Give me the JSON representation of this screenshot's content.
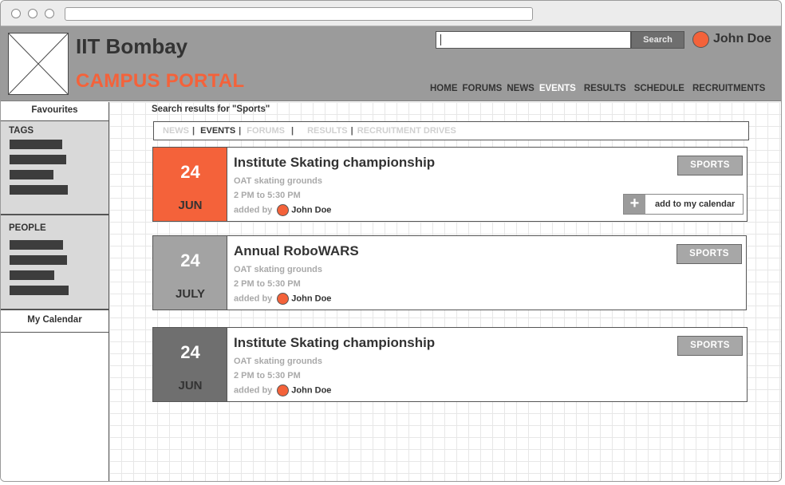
{
  "header": {
    "site_title": "IIT Bombay",
    "site_subtitle": "CAMPUS PORTAL",
    "search_button": "Search",
    "search_value": "",
    "user_name": "John Doe",
    "nav": [
      "HOME",
      "FORUMS",
      "NEWS",
      "EVENTS",
      "RESULTS",
      "SCHEDULE",
      "RECRUITMENTS"
    ],
    "nav_active": "EVENTS"
  },
  "sidebar": {
    "favourites": "Favourites",
    "tags_label": "TAGS",
    "people_label": "PEOPLE",
    "my_calendar": "My Calendar"
  },
  "main": {
    "results_label": "Search results for \"Sports\"",
    "filters": [
      "NEWS",
      "EVENTS",
      "FORUMS",
      "RESULTS",
      "RECRUITMENT DRIVES"
    ],
    "filter_active": "EVENTS",
    "events": [
      {
        "day": "24",
        "month": "JUN",
        "title": "Institute Skating championship",
        "location": "OAT skating grounds",
        "time": "2 PM to 5:30 PM",
        "added_by_label": "added by",
        "added_by": "John Doe",
        "tag": "SPORTS",
        "calendar_action": "add to my calendar",
        "date_color": "#f4623a"
      },
      {
        "day": "24",
        "month": "JULY",
        "title": "Annual RoboWARS",
        "location": "OAT skating grounds",
        "time": "2 PM to 5:30 PM",
        "added_by_label": "added by",
        "added_by": "John Doe",
        "tag": "SPORTS",
        "date_color": "#a3a3a3"
      },
      {
        "day": "24",
        "month": "JUN",
        "title": "Institute Skating championship",
        "location": "OAT skating grounds",
        "time": "2 PM to 5:30 PM",
        "added_by_label": "added by",
        "added_by": "John Doe",
        "tag": "SPORTS",
        "date_color": "#6f6f6f"
      }
    ]
  },
  "colors": {
    "accent": "#f4623a",
    "header_bg": "#9b9b9b"
  }
}
